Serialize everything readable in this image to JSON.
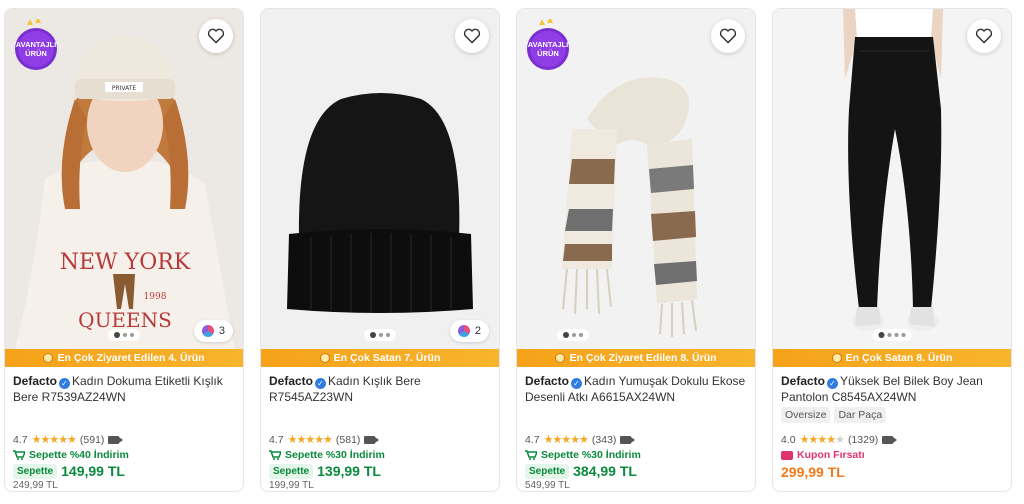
{
  "products": [
    {
      "advantage_badge": "AVANTAJLI ÜRÜN",
      "strip": "En Çok Ziyaret Edilen 4. Ürün",
      "brand": "Defacto",
      "name": "Kadın Dokuma Etiketli Kışlık Bere R7539AZ24WN",
      "rating": "4.7",
      "reviews": "(591)",
      "cart_note": "Sepette %40 İndirim",
      "cart_label": "Sepette",
      "cart_price": "149,99 TL",
      "old_price": "249,99 TL",
      "variant_count": "3"
    },
    {
      "strip": "En Çok Satan 7. Ürün",
      "brand": "Defacto",
      "name": "Kadın Kışlık Bere R7545AZ23WN",
      "rating": "4.7",
      "reviews": "(581)",
      "cart_note": "Sepette %30 İndirim",
      "cart_label": "Sepette",
      "cart_price": "139,99 TL",
      "old_price": "199,99 TL",
      "variant_count": "2"
    },
    {
      "advantage_badge": "AVANTAJLI ÜRÜN",
      "strip": "En Çok Ziyaret Edilen 8. Ürün",
      "brand": "Defacto",
      "name": "Kadın Yumuşak Dokulu Ekose Desenli Atkı A6615AX24WN",
      "rating": "4.7",
      "reviews": "(343)",
      "cart_note": "Sepette %30 İndirim",
      "cart_label": "Sepette",
      "cart_price": "384,99 TL",
      "old_price": "549,99 TL"
    },
    {
      "strip": "En Çok Satan 8. Ürün",
      "brand": "Defacto",
      "name": "Yüksek Bel Bilek Boy Jean Pantolon C8545AX24WN",
      "tags": [
        "Oversize",
        "Dar Paça"
      ],
      "rating": "4.0",
      "reviews": "(1329)",
      "coupon": "Kupon Fırsatı",
      "price": "299,99 TL"
    }
  ],
  "colors": {
    "accent_orange": "#f27a1a",
    "discount_green": "#0a8a3c",
    "strip_orange": "#f6a21a",
    "badge_purple": "#7b2fd0"
  },
  "icons": [
    "heart-icon",
    "verified-icon",
    "cart-icon",
    "video-icon",
    "coupon-icon",
    "bulb-icon",
    "color-variants-icon"
  ]
}
